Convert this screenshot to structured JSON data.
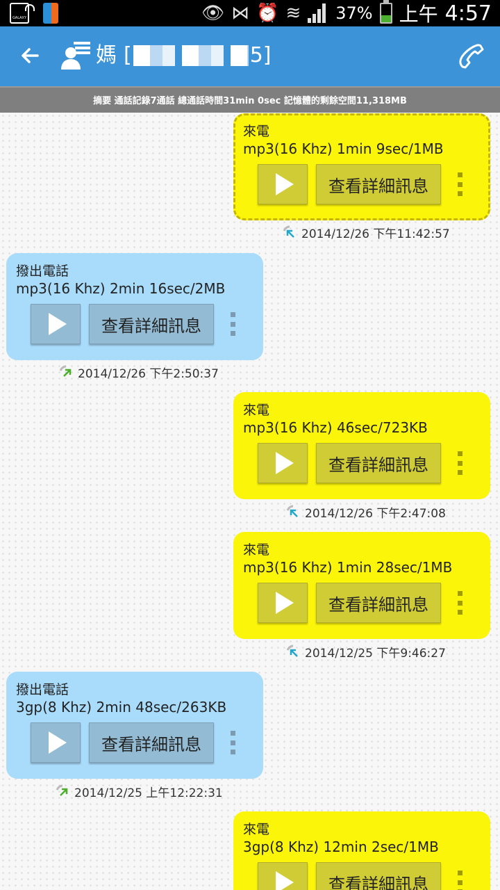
{
  "status_bar": {
    "battery": "37%",
    "ampm": "上午",
    "time": "4:57",
    "icons": [
      "galaxy-icon",
      "app-icon",
      "eye-icon",
      "nfc-off-icon",
      "alarm-icon",
      "wifi-icon",
      "signal-icon",
      "battery-icon"
    ]
  },
  "toolbar": {
    "contact_name": "媽",
    "number_open": "[",
    "number_tail": "5]",
    "accent": "#3d93d8"
  },
  "summary": {
    "text": "摘要  通話記錄7通話  總通話時間31min 0sec  記憶體的剩餘空間11,318MB"
  },
  "calls": [
    {
      "kind": "incoming",
      "type": "來電",
      "info": "mp3(16 Khz)  1min 9sec/1MB",
      "detail": "查看詳細訊息",
      "timestamp": "2014/12/26 下午11:42:57",
      "selected": true
    },
    {
      "kind": "outgoing",
      "type": "撥出電話",
      "info": "mp3(16 Khz)  2min 16sec/2MB",
      "detail": "查看詳細訊息",
      "timestamp": "2014/12/26 下午2:50:37",
      "selected": false
    },
    {
      "kind": "incoming",
      "type": "來電",
      "info": "mp3(16 Khz)  46sec/723KB",
      "detail": "查看詳細訊息",
      "timestamp": "2014/12/26 下午2:47:08",
      "selected": false
    },
    {
      "kind": "incoming",
      "type": "來電",
      "info": "mp3(16 Khz)  1min 28sec/1MB",
      "detail": "查看詳細訊息",
      "timestamp": "2014/12/25 下午9:46:27",
      "selected": false
    },
    {
      "kind": "outgoing",
      "type": "撥出電話",
      "info": "3gp(8 Khz)  2min 48sec/263KB",
      "detail": "查看詳細訊息",
      "timestamp": "2014/12/25 上午12:22:31",
      "selected": false
    },
    {
      "kind": "incoming",
      "type": "來電",
      "info": "3gp(8 Khz)  12min 2sec/1MB",
      "detail": "查看詳細訊息",
      "timestamp": "",
      "selected": false
    }
  ],
  "colors": {
    "incoming_bubble": "#fbf509",
    "outgoing_bubble": "#a9dcfb"
  }
}
